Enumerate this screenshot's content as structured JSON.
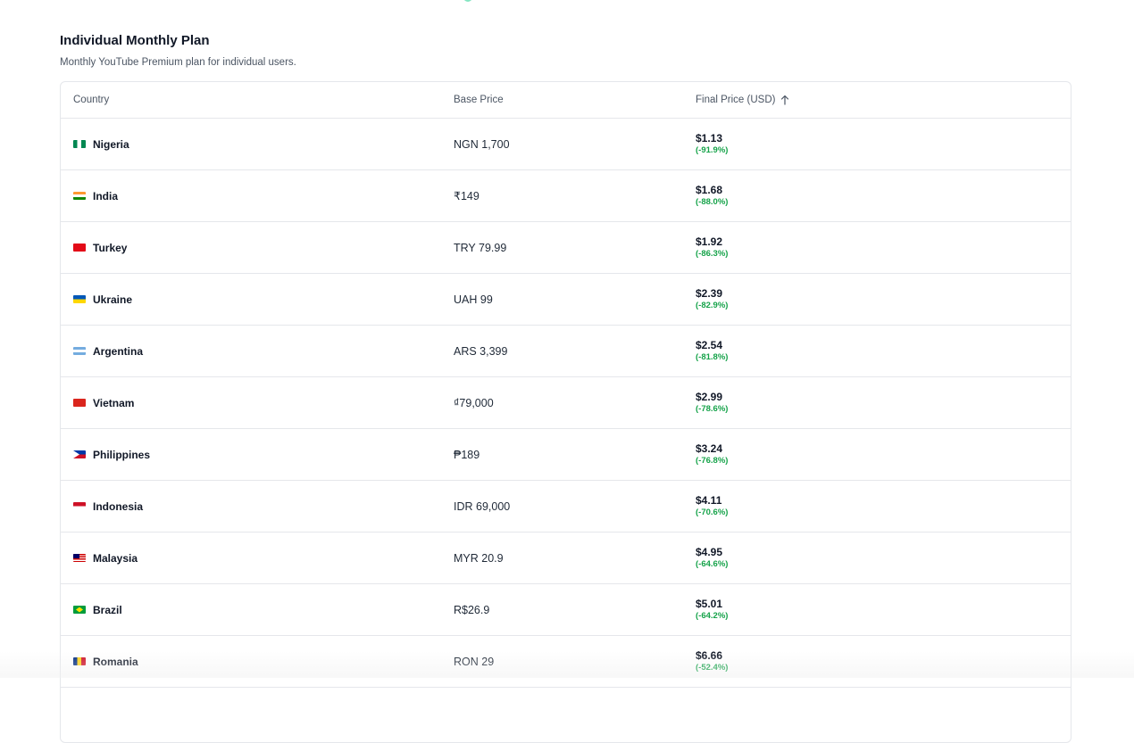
{
  "section": {
    "title": "Individual Monthly Plan",
    "subtitle": "Monthly YouTube Premium plan for individual users."
  },
  "table": {
    "headers": {
      "country": "Country",
      "base_price": "Base Price",
      "final_price": "Final Price (USD)"
    },
    "sort_icon": "arrow-up-icon",
    "rows": [
      {
        "country": "Nigeria",
        "flag": "nigeria-flag-icon",
        "base": "NGN 1,700",
        "final": "$1.13",
        "diff": "(-91.9%)"
      },
      {
        "country": "India",
        "flag": "india-flag-icon",
        "base": "₹149",
        "final": "$1.68",
        "diff": "(-88.0%)"
      },
      {
        "country": "Turkey",
        "flag": "turkey-flag-icon",
        "base": "TRY 79.99",
        "final": "$1.92",
        "diff": "(-86.3%)"
      },
      {
        "country": "Ukraine",
        "flag": "ukraine-flag-icon",
        "base": "UAH 99",
        "final": "$2.39",
        "diff": "(-82.9%)"
      },
      {
        "country": "Argentina",
        "flag": "argentina-flag-icon",
        "base": "ARS 3,399",
        "final": "$2.54",
        "diff": "(-81.8%)"
      },
      {
        "country": "Vietnam",
        "flag": "vietnam-flag-icon",
        "base": "₫79,000",
        "final": "$2.99",
        "diff": "(-78.6%)"
      },
      {
        "country": "Philippines",
        "flag": "philippines-flag-icon",
        "base": "₱189",
        "final": "$3.24",
        "diff": "(-76.8%)"
      },
      {
        "country": "Indonesia",
        "flag": "indonesia-flag-icon",
        "base": "IDR 69,000",
        "final": "$4.11",
        "diff": "(-70.6%)"
      },
      {
        "country": "Malaysia",
        "flag": "malaysia-flag-icon",
        "base": "MYR 20.9",
        "final": "$4.95",
        "diff": "(-64.6%)"
      },
      {
        "country": "Brazil",
        "flag": "brazil-flag-icon",
        "base": "R$26.9",
        "final": "$5.01",
        "diff": "(-64.2%)"
      },
      {
        "country": "Romania",
        "flag": "romania-flag-icon",
        "base": "RON 29",
        "final": "$6.66",
        "diff": "(-52.4%)"
      }
    ]
  },
  "colors": {
    "accent_green": "#16a34a",
    "border": "#e5e7eb",
    "muted_text": "#4b5563"
  }
}
